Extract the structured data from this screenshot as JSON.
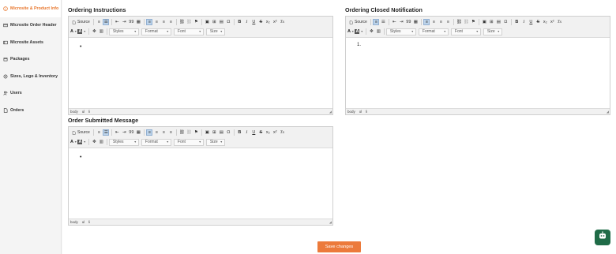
{
  "sidebar": {
    "items": [
      {
        "label": "Microsite & Product Info",
        "icon": "info-icon",
        "active": true
      },
      {
        "label": "Microsite Order Header",
        "icon": "header-icon",
        "active": false
      },
      {
        "label": "Microsite Assets",
        "icon": "assets-icon",
        "active": false
      },
      {
        "label": "Packages",
        "icon": "package-icon",
        "active": false
      },
      {
        "label": "Sizes, Logo & Inventory",
        "icon": "inventory-icon",
        "active": false
      },
      {
        "label": "Users",
        "icon": "users-icon",
        "active": false
      },
      {
        "label": "Orders",
        "icon": "orders-icon",
        "active": false
      }
    ]
  },
  "editors": {
    "ordering_instructions": {
      "title": "Ordering Instructions",
      "marker": "•"
    },
    "ordering_closed": {
      "title": "Ordering Closed Notification",
      "marker": "1."
    },
    "order_submitted": {
      "title": "Order Submitted Message",
      "marker": "•"
    }
  },
  "toolbar": {
    "source": "Source",
    "styles": "Styles",
    "format": "Format",
    "font": "Font",
    "size": "Size",
    "bold": "B",
    "italic": "I",
    "underline": "U",
    "strike": "S",
    "subscript": "x₂",
    "superscript": "x²",
    "clear": "Tx",
    "blockquote": "99",
    "special_char": "Ω",
    "text_color": "A",
    "bg_color": "A"
  },
  "statusbar": {
    "body": "body",
    "ul": "ul",
    "li": "li",
    "ol": "ol"
  },
  "actions": {
    "save": "Save changes"
  },
  "colors": {
    "accent": "#ec7a3b",
    "active_nav": "#e8772e",
    "chat": "#1f6b47"
  }
}
